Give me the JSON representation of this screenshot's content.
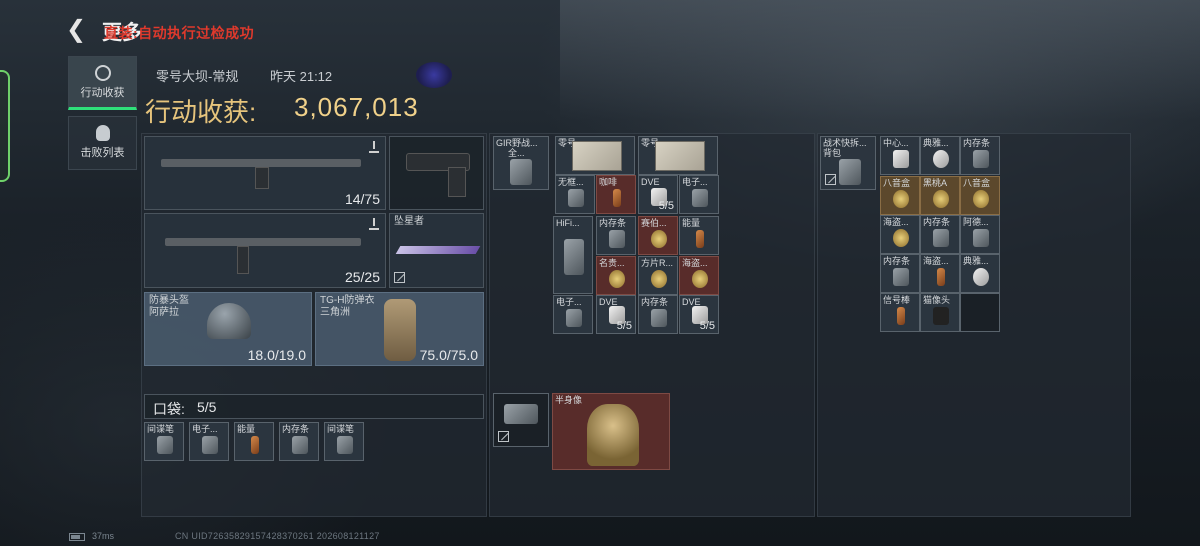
{
  "topbar": {
    "back_icon": "chevron-left-icon",
    "title": "更多",
    "overlay_message": "直装:自动执行过检成功"
  },
  "tabs": [
    {
      "label": "行动收获",
      "icon": "target-icon",
      "active": true
    },
    {
      "label": "击败列表",
      "icon": "skull-icon",
      "active": false
    }
  ],
  "header": {
    "map": "零号大坝-常规",
    "time": "昨天 21:12",
    "haul_label": "行动收获:",
    "haul_value": "3,067,013"
  },
  "loadout": {
    "primary_ammo": "14/75",
    "secondary_ammo": "25/25",
    "melee_name": "坠星者",
    "helmet": {
      "name_line1": "防暴头盔",
      "name_line2": "阿萨拉",
      "durability": "18.0/19.0"
    },
    "armor": {
      "name_line1": "TG-H防弹衣",
      "name_line2": "三角洲",
      "durability": "75.0/75.0"
    }
  },
  "pocket": {
    "label": "口袋:",
    "count": "5/5",
    "items": [
      "间谍笔",
      "电子...",
      "能量",
      "内存条",
      "间谍笔"
    ]
  },
  "chest_rig": {
    "name": "GIR野战...",
    "sub": "全...",
    "top_items": [
      {
        "name": "零号...",
        "count": ""
      },
      {
        "name": "零号...",
        "count": ""
      }
    ],
    "row2": [
      {
        "name": "无框...",
        "count": ""
      },
      {
        "name": "咖啡",
        "count": ""
      },
      {
        "name": "DVE",
        "count": "5/5"
      },
      {
        "name": "电子...",
        "count": ""
      }
    ],
    "grid": [
      {
        "name": "HiFi...",
        "count": ""
      },
      {
        "name": "内存条",
        "count": ""
      },
      {
        "name": "赛伯...",
        "count": ""
      },
      {
        "name": "能量",
        "count": ""
      },
      {
        "name": "名贵...",
        "count": ""
      },
      {
        "name": "方片R...",
        "count": ""
      },
      {
        "name": "海盗...",
        "count": ""
      },
      {
        "name": "电子...",
        "count": ""
      },
      {
        "name": "DVE",
        "count": "5/5"
      },
      {
        "name": "内存条",
        "count": ""
      },
      {
        "name": "DVE",
        "count": "5/5"
      }
    ],
    "bust_name": "半身像"
  },
  "backpack": {
    "name": "战术快拆...",
    "sub": "背包",
    "grid": [
      "中心...",
      "典雅...",
      "内存条",
      "八音盒",
      "黑桃A",
      "八音盒",
      "海盗...",
      "内存条",
      "阿德...",
      "内存条",
      "海盗...",
      "典雅...",
      "信号棒",
      "猫像头"
    ]
  },
  "status": {
    "ping": "37ms",
    "uid": "CN UID726358291574283702​61 202608121127"
  }
}
